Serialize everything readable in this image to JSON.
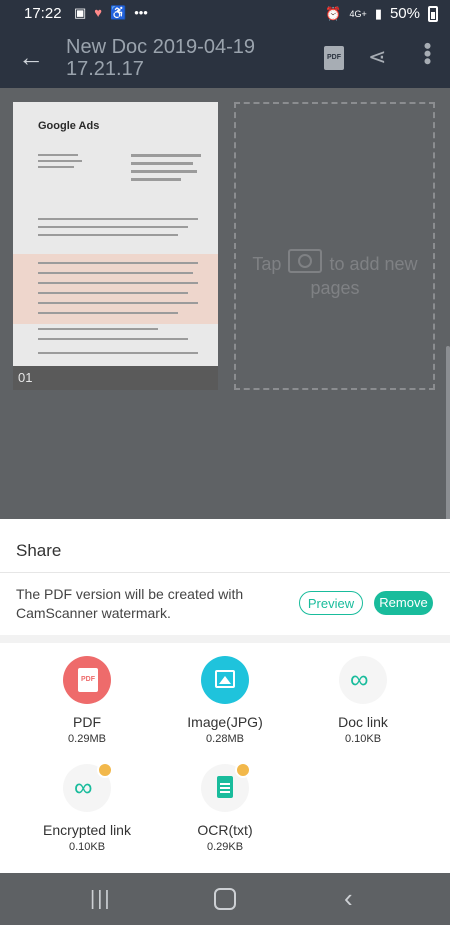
{
  "status_bar": {
    "time": "17:22",
    "left_icons": [
      "image-icon",
      "heart-pulse-icon",
      "accessibility-icon",
      "more-dots-icon"
    ],
    "right_icons": [
      "alarm-icon",
      "4g-plus-icon",
      "signal-icon"
    ],
    "network": "4G+",
    "battery": "50%"
  },
  "app_bar": {
    "title": "New Doc 2019-04-19 17.21.17",
    "pdf_icon_label": "PDF"
  },
  "document": {
    "thumbnail_header": "Google Ads",
    "page_number": "01",
    "add_page_hint_before": "Tap",
    "add_page_hint_after": "to add new pages"
  },
  "share_sheet": {
    "title": "Share",
    "watermark_notice": "The PDF version will be created with CamScanner watermark.",
    "preview_label": "Preview",
    "remove_label": "Remove",
    "options": [
      {
        "label": "PDF",
        "size": "0.29MB",
        "icon": "pdf-icon",
        "color": "#ee6b6b",
        "premium": false
      },
      {
        "label": "Image(JPG)",
        "size": "0.28MB",
        "icon": "image-icon",
        "color": "#1fc3dc",
        "premium": false
      },
      {
        "label": "Doc link",
        "size": "0.10KB",
        "icon": "link-icon",
        "color": "#f5f5f5",
        "premium": false
      },
      {
        "label": "Encrypted link",
        "size": "0.10KB",
        "icon": "locked-link-icon",
        "color": "#f5f5f5",
        "premium": true
      },
      {
        "label": "OCR(txt)",
        "size": "0.29KB",
        "icon": "text-document-icon",
        "color": "#f5f5f5",
        "premium": true
      }
    ]
  },
  "colors": {
    "accent": "#19bc9c",
    "app_bar": "#2b3340",
    "premium_badge": "#f2b84b"
  }
}
